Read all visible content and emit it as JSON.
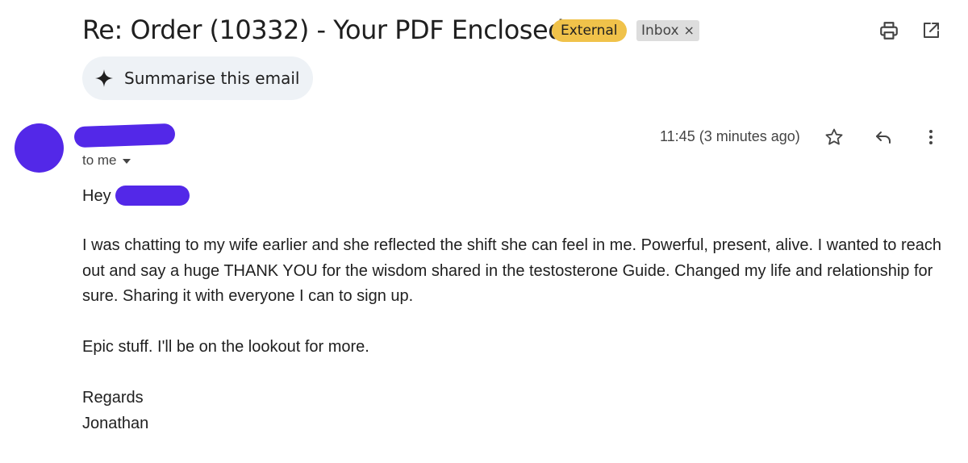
{
  "subject": "Re: Order (10332) - Your PDF Enclosed",
  "labels": {
    "external": "External",
    "inbox": "Inbox",
    "inbox_remove": "×"
  },
  "toolbar_icons": [
    "print-icon",
    "open-in-new-window-icon"
  ],
  "summarise": {
    "label": "Summarise this email",
    "icon": "sparkle-icon"
  },
  "message": {
    "to_me": "to me",
    "timestamp": "11:45 (3 minutes ago)",
    "actions": [
      "star-icon",
      "reply-icon",
      "more-vertical-icon"
    ],
    "greeting": "Hey",
    "paragraphs": [
      "I was chatting to my wife earlier and she reflected the shift she can feel in me. Powerful, present, alive. I wanted to reach out and say a huge THANK YOU for the wisdom shared in the testosterone Guide. Changed my life and relationship for sure. Sharing it with everyone I can to sign up.",
      "Epic stuff. I'll be on the lookout for more."
    ],
    "signoff": "Regards",
    "signature": "Jonathan"
  },
  "colors": {
    "redaction": "#5328e8",
    "external_badge": "#f0c24a",
    "inbox_badge": "#dddddd",
    "summarise_bg": "#eef2f6"
  }
}
